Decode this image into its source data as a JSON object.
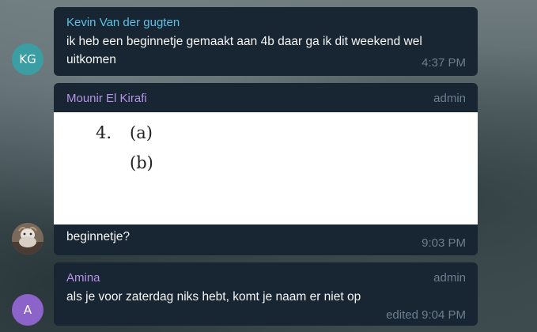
{
  "messages": [
    {
      "avatar_initials": "KG",
      "avatar_color": "#3a9ea2",
      "sender": "Kevin Van der gugten",
      "sender_color": "#5fc0e6",
      "text": "ik heb een beginnetje gemaakt aan 4b daar ga ik dit weekend wel uitkomen",
      "time": "4:37 PM"
    },
    {
      "avatar_icon": "user-photo",
      "sender": "Mounir El Kirafi",
      "sender_color": "#b592e8",
      "role": "admin",
      "image": {
        "number": "4.",
        "items": [
          "(a)",
          "(b)"
        ]
      },
      "text": "beginnetje?",
      "time": "9:03 PM"
    },
    {
      "avatar_initials": "A",
      "avatar_color": "#8c63c8",
      "sender": "Amina",
      "sender_color": "#b592e8",
      "role": "admin",
      "text": "als je voor zaterdag niks hebt, komt je naam er niet op",
      "time": "edited 9:04 PM"
    }
  ]
}
